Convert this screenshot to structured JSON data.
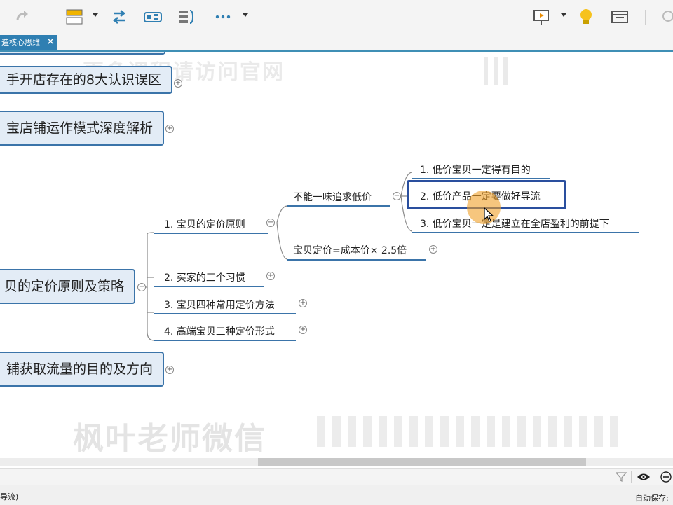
{
  "tab": {
    "title": "造核心思维"
  },
  "topics": [
    {
      "label": "手开店存在的8大认识误区"
    },
    {
      "label": "宝店铺运作模式深度解析"
    },
    {
      "label": "贝的定价原则及策略"
    },
    {
      "label": "铺获取流量的目的及方向"
    }
  ],
  "subtopics": [
    {
      "label": "1. 宝贝的定价原则"
    },
    {
      "label": "2. 买家的三个习惯"
    },
    {
      "label": "3. 宝贝四种常用定价方法"
    },
    {
      "label": "4. 高端宝贝三种定价形式"
    }
  ],
  "level3": [
    {
      "label": "不能一味追求低价"
    },
    {
      "label": "宝贝定价=成本价× 2.5倍"
    }
  ],
  "level4": [
    {
      "label": "1. 低价宝贝一定得有目的"
    },
    {
      "label": "2. 低价产品一定要做好导流"
    },
    {
      "label": "3. 低价宝贝一定是建立在全店盈利的前提下"
    }
  ],
  "toggle_symbols": {
    "collapsed": "+",
    "expanded": "−"
  },
  "watermarks": {
    "top": "更多课程请访问官网",
    "bottom": "枫叶老师微信"
  },
  "status": {
    "left_text": "导流)",
    "autosave": "自动保存: "
  },
  "colors": {
    "accent": "#3b74a9",
    "topic_fill": "#e3ecf6",
    "tab": "#2f7fb2",
    "selection": "#2a4f9e"
  }
}
